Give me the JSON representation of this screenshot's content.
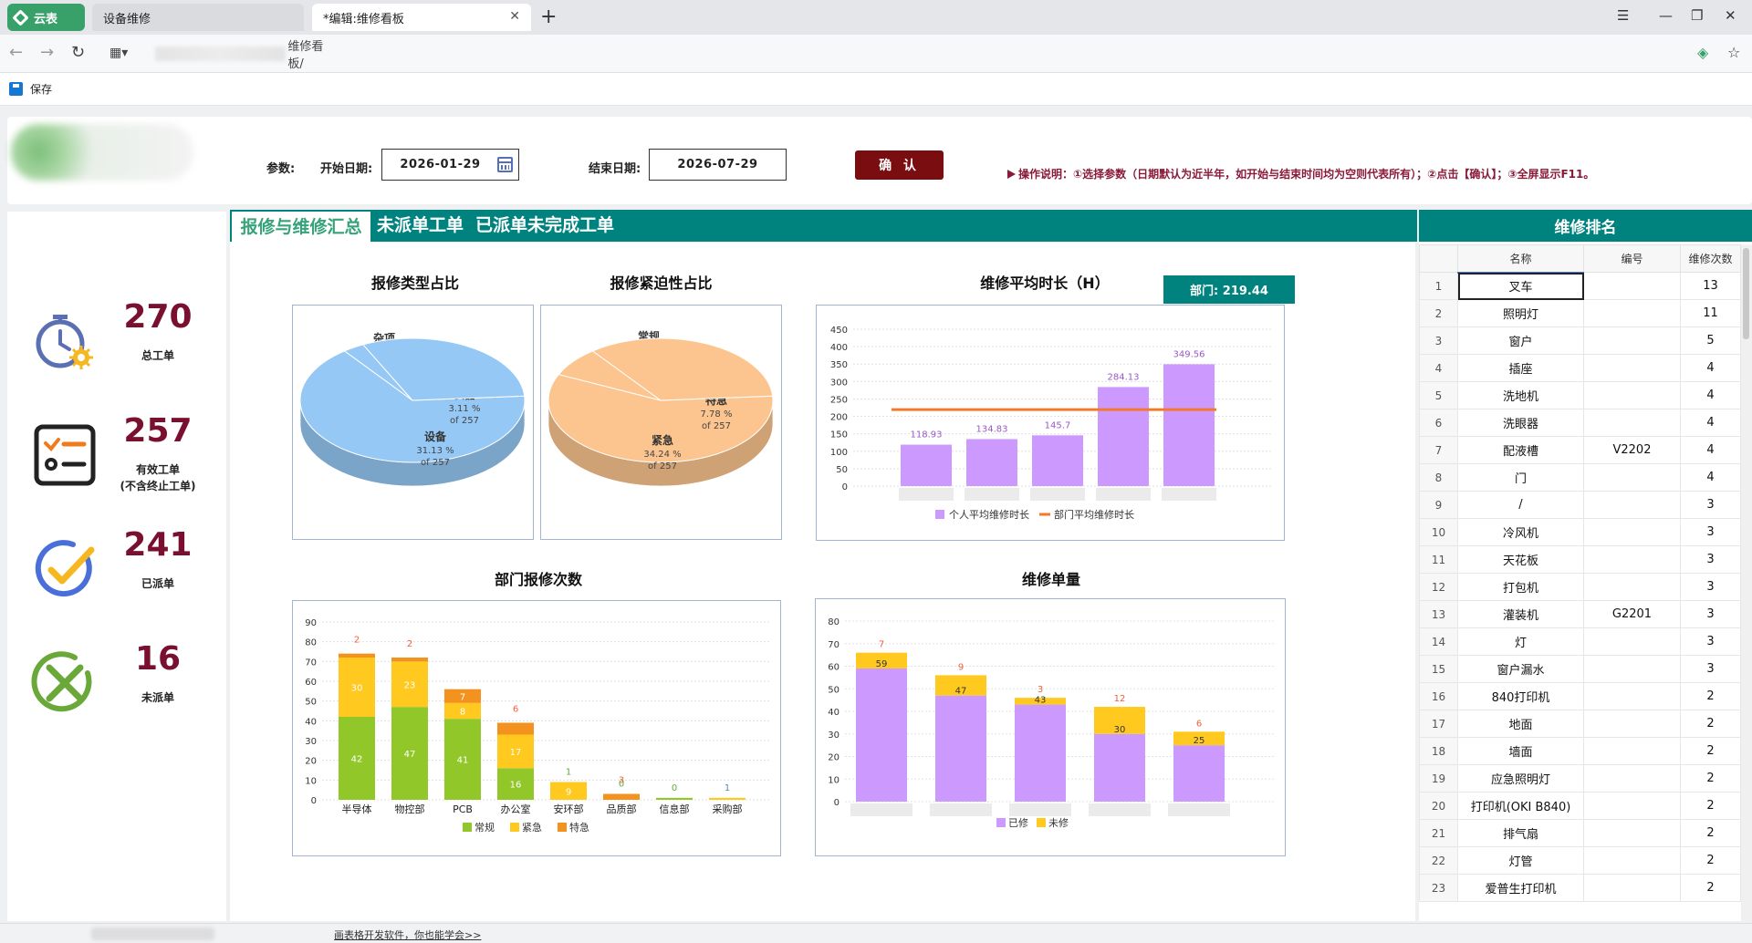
{
  "browser": {
    "app_tab": "云表",
    "tabs": [
      {
        "label": "设备维修"
      },
      {
        "label": "*编辑:维修看板"
      }
    ],
    "address_suffix": "维修看板/",
    "save_label": "保存"
  },
  "header": {
    "params_label": "参数:",
    "start_label": "开始日期:",
    "start_value": "2026-01-29",
    "end_label": "结束日期:",
    "end_value": "2026-07-29",
    "confirm_label": "确 认",
    "hint": "操作说明：①选择参数（日期默认为近半年，如开始与结束时间均为空则代表所有）；②点击【确认】；③全屏显示F11。"
  },
  "kpis": [
    {
      "value": "270",
      "label": "总工单",
      "icon": "stopwatch-gear-icon"
    },
    {
      "value": "257",
      "label": "有效工单",
      "sublabel": "(不含终止工单)",
      "icon": "checklist-icon"
    },
    {
      "value": "241",
      "label": "已派单",
      "icon": "check-circle-icon"
    },
    {
      "value": "16",
      "label": "未派单",
      "icon": "cross-circle-icon"
    }
  ],
  "center_tabs": [
    "报修与维修汇总",
    "未派单工单",
    "已派单未完成工单"
  ],
  "charts": {
    "repair_type": {
      "title": "报修类型占比"
    },
    "urgency": {
      "title": "报修紧迫性占比"
    },
    "avg_time": {
      "title": "维修平均时长（H）",
      "badge": "部门: 219.44"
    },
    "dept_counts": {
      "title": "部门报修次数"
    },
    "repair_volume": {
      "title": "维修单量"
    }
  },
  "chart_data": [
    {
      "type": "pie",
      "title": "报修类型占比",
      "total": 257,
      "slices": [
        {
          "label": "杂项",
          "percent": 65.76,
          "text": "65.76 %",
          "of": "of 257",
          "color": "#96c8f5"
        },
        {
          "label": "仪器",
          "percent": 3.11,
          "text": "3.11 %",
          "of": "of 257",
          "color": "#96c8f5"
        },
        {
          "label": "设备",
          "percent": 31.13,
          "text": "31.13 %",
          "of": "of 257",
          "color": "#96c8f5"
        }
      ]
    },
    {
      "type": "pie",
      "title": "报修紧迫性占比",
      "total": 257,
      "slices": [
        {
          "label": "常规",
          "percent": 57.98,
          "text": "57.98 %",
          "of": "of 257",
          "color": "#fcc58f"
        },
        {
          "label": "特急",
          "percent": 7.78,
          "text": "7.78 %",
          "of": "of 257",
          "color": "#fcc58f"
        },
        {
          "label": "紧急",
          "percent": 34.24,
          "text": "34.24 %",
          "of": "of 257",
          "color": "#fcc58f"
        }
      ]
    },
    {
      "type": "bar",
      "title": "维修平均时长（H）",
      "ylim": [
        0,
        450
      ],
      "yticks": [
        0,
        50,
        100,
        150,
        200,
        250,
        300,
        350,
        400,
        450
      ],
      "series": [
        {
          "name": "个人平均维修时长",
          "values": [
            118.93,
            134.83,
            145.7,
            284.13,
            349.56
          ],
          "labels": [
            "118.93",
            "134.83",
            "145.7",
            "284.13",
            "349.56"
          ],
          "color": "#cc99ff"
        },
        {
          "name": "部门平均维修时长",
          "values": [
            219.44,
            219.44,
            219.44,
            219.44,
            219.44
          ],
          "color": "#f37a2a",
          "type": "line"
        }
      ]
    },
    {
      "type": "bar",
      "title": "部门报修次数",
      "stacked": true,
      "categories": [
        "半导体",
        "物控部",
        "PCB",
        "办公室",
        "安环部",
        "品质部",
        "信息部",
        "采购部"
      ],
      "ylim": [
        0,
        90
      ],
      "yticks": [
        0,
        10,
        20,
        30,
        40,
        50,
        60,
        70,
        80,
        90
      ],
      "series": [
        {
          "name": "常规",
          "values": [
            42,
            47,
            41,
            16,
            0,
            0,
            1,
            0
          ],
          "color": "#92c72a"
        },
        {
          "name": "紧急",
          "values": [
            30,
            23,
            8,
            17,
            9,
            0,
            0,
            1
          ],
          "color": "#ffc91f"
        },
        {
          "name": "特急",
          "values": [
            2,
            2,
            7,
            6,
            0,
            3,
            0,
            0
          ],
          "color": "#f4921f"
        }
      ],
      "data_labels": [
        {
          "category": 0,
          "series": 0,
          "text": "42"
        },
        {
          "category": 0,
          "series": 1,
          "text": "30"
        },
        {
          "category": 0,
          "series": 2,
          "text": "2"
        },
        {
          "category": 1,
          "series": 0,
          "text": "47"
        },
        {
          "category": 1,
          "series": 1,
          "text": "23"
        },
        {
          "category": 1,
          "series": 2,
          "text": "2"
        },
        {
          "category": 2,
          "series": 0,
          "text": "41"
        },
        {
          "category": 2,
          "series": 1,
          "text": "8"
        },
        {
          "category": 2,
          "series": 2,
          "text": "7"
        },
        {
          "category": 3,
          "series": 0,
          "text": "16"
        },
        {
          "category": 3,
          "series": 1,
          "text": "17"
        },
        {
          "category": 3,
          "series": 2,
          "text": "6"
        },
        {
          "category": 4,
          "series": 1,
          "text": "9"
        },
        {
          "category": 4,
          "series": 0,
          "text": "1"
        },
        {
          "category": 5,
          "series": 2,
          "text": "3"
        },
        {
          "category": 5,
          "series": 0,
          "text": "0"
        },
        {
          "category": 6,
          "series": 0,
          "text": "0"
        },
        {
          "category": 7,
          "series": 1,
          "text": "1"
        }
      ]
    },
    {
      "type": "bar",
      "title": "维修单量",
      "stacked": true,
      "ylim": [
        0,
        80
      ],
      "yticks": [
        0,
        10,
        20,
        30,
        40,
        50,
        60,
        70,
        80
      ],
      "series": [
        {
          "name": "已修",
          "values": [
            59,
            47,
            43,
            30,
            25
          ],
          "color": "#cc99ff"
        },
        {
          "name": "未修",
          "values": [
            7,
            9,
            3,
            12,
            6
          ],
          "color": "#ffc91f"
        }
      ]
    }
  ],
  "ranking": {
    "title": "维修排名",
    "columns": [
      "名称",
      "编号",
      "维修次数"
    ],
    "rows": [
      {
        "i": "1",
        "name": "叉车",
        "code": "",
        "count": "13"
      },
      {
        "i": "2",
        "name": "照明灯",
        "code": "",
        "count": "11"
      },
      {
        "i": "3",
        "name": "窗户",
        "code": "",
        "count": "5"
      },
      {
        "i": "4",
        "name": "插座",
        "code": "",
        "count": "4"
      },
      {
        "i": "5",
        "name": "洗地机",
        "code": "",
        "count": "4"
      },
      {
        "i": "6",
        "name": "洗眼器",
        "code": "",
        "count": "4"
      },
      {
        "i": "7",
        "name": "配液槽",
        "code": "V2202",
        "count": "4"
      },
      {
        "i": "8",
        "name": "门",
        "code": "",
        "count": "4"
      },
      {
        "i": "9",
        "name": "/",
        "code": "",
        "count": "3"
      },
      {
        "i": "10",
        "name": "冷风机",
        "code": "",
        "count": "3"
      },
      {
        "i": "11",
        "name": "天花板",
        "code": "",
        "count": "3"
      },
      {
        "i": "12",
        "name": "打包机",
        "code": "",
        "count": "3"
      },
      {
        "i": "13",
        "name": "灌装机",
        "code": "G2201",
        "count": "3"
      },
      {
        "i": "14",
        "name": "灯",
        "code": "",
        "count": "3"
      },
      {
        "i": "15",
        "name": "窗户漏水",
        "code": "",
        "count": "3"
      },
      {
        "i": "16",
        "name": "840打印机",
        "code": "",
        "count": "2"
      },
      {
        "i": "17",
        "name": "地面",
        "code": "",
        "count": "2"
      },
      {
        "i": "18",
        "name": "墙面",
        "code": "",
        "count": "2"
      },
      {
        "i": "19",
        "name": "应急照明灯",
        "code": "",
        "count": "2"
      },
      {
        "i": "20",
        "name": "打印机(OKI B840)",
        "code": "",
        "count": "2"
      },
      {
        "i": "21",
        "name": "排气扇",
        "code": "",
        "count": "2"
      },
      {
        "i": "22",
        "name": "灯管",
        "code": "",
        "count": "2"
      },
      {
        "i": "23",
        "name": "爱普生打印机",
        "code": "",
        "count": "2"
      }
    ]
  },
  "footer": {
    "link": "画表格开发软件，你也能学会>>"
  }
}
